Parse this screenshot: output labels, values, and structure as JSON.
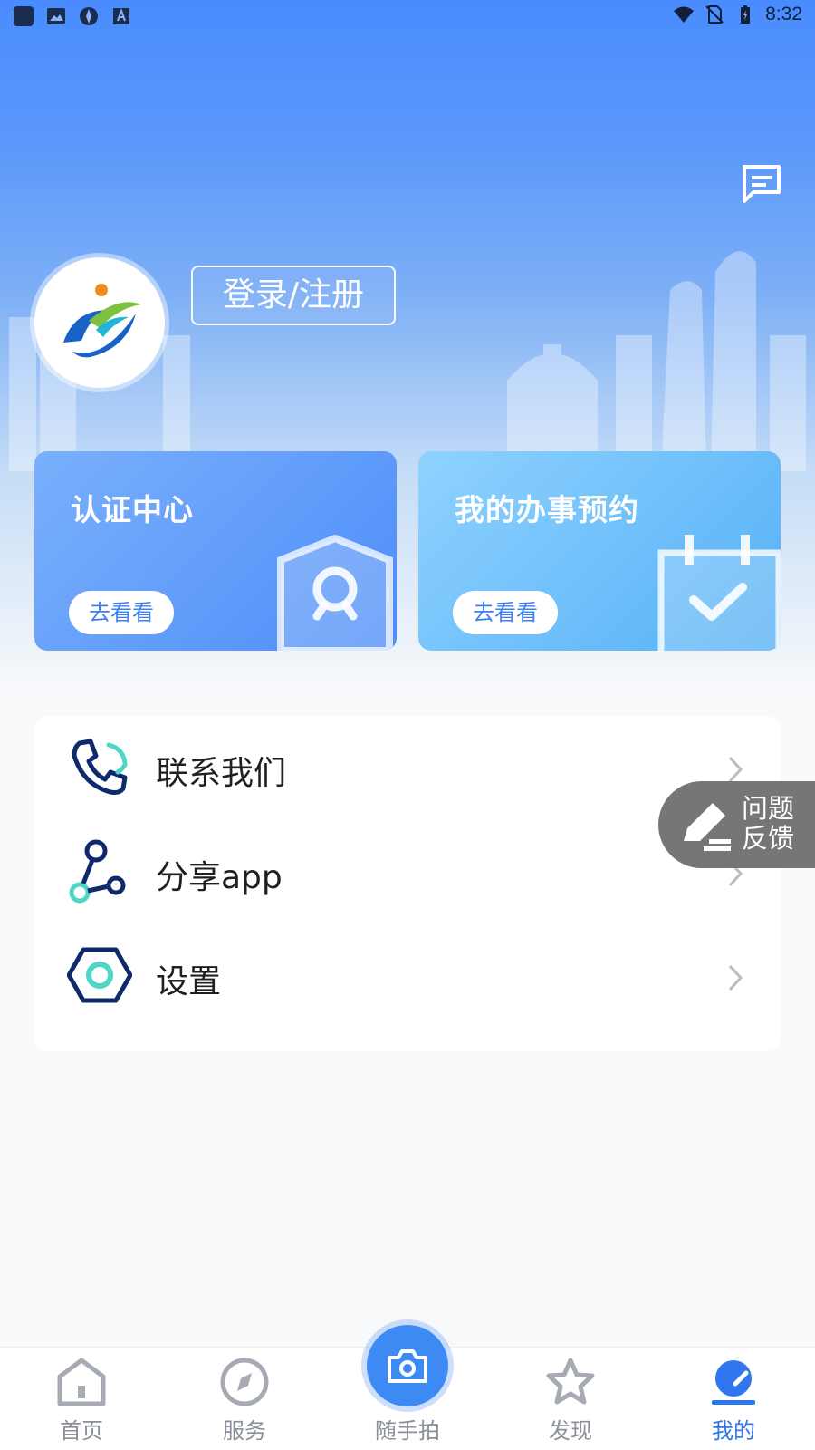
{
  "status_bar": {
    "time": "8:32",
    "left_icons": [
      "app-square-icon",
      "image-icon",
      "vpn-icon",
      "font-icon"
    ],
    "right_icons": [
      "wifi-icon",
      "no-sim-icon",
      "battery-icon"
    ]
  },
  "header": {
    "message_icon": "message-icon",
    "login_label": "登录/注册"
  },
  "cards": [
    {
      "title": "认证中心",
      "action": "去看看",
      "icon": "shield-icon"
    },
    {
      "title": "我的办事预约",
      "action": "去看看",
      "icon": "calendar-check-icon"
    }
  ],
  "menu": {
    "items": [
      {
        "label": "联系我们",
        "icon": "phone-icon"
      },
      {
        "label": "分享app",
        "icon": "share-icon"
      },
      {
        "label": "设置",
        "icon": "settings-icon"
      }
    ]
  },
  "feedback": {
    "line1": "问题",
    "line2": "反馈",
    "icon": "edit-icon"
  },
  "bottom_nav": {
    "items": [
      {
        "label": "首页",
        "icon": "home-icon"
      },
      {
        "label": "服务",
        "icon": "compass-icon"
      },
      {
        "label": "随手拍",
        "icon": "camera-icon"
      },
      {
        "label": "发现",
        "icon": "star-icon"
      },
      {
        "label": "我的",
        "icon": "profile-icon"
      }
    ],
    "active_index": 4
  },
  "colors": {
    "accent": "#2f76ef",
    "hero_top": "#4a8cff",
    "navy": "#0e2a6b",
    "teal": "#4fd6c7"
  }
}
